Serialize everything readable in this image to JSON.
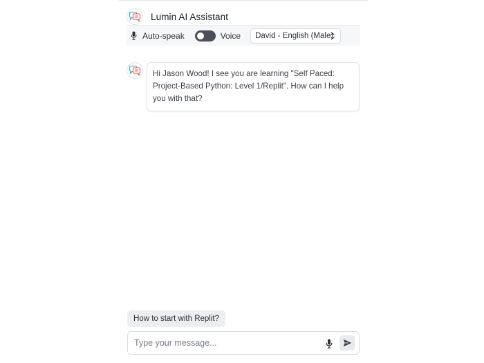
{
  "header": {
    "title": "Lumin AI Assistant",
    "logo_icon": "chat-bubbles-icon"
  },
  "controls": {
    "autospeak_label": "Auto-speak",
    "autospeak_enabled": false,
    "voice_label": "Voice",
    "voice_selected": "David - English (Male)",
    "icons": {
      "mic": "microphone-icon",
      "select": "chevron-up-down-icon"
    }
  },
  "messages": [
    {
      "sender": "assistant",
      "text": "Hi Jason Wood! I see you are learning \"Self Paced: Project-Based Python: Level 1/Replit\". How can I help you with that?"
    }
  ],
  "suggestions": [
    "How to start with Replit?"
  ],
  "composer": {
    "placeholder": "Type your message...",
    "value": "",
    "icons": {
      "mic": "microphone-icon",
      "send": "send-arrow-icon"
    }
  },
  "colors": {
    "logo_red": "#e0584f",
    "logo_teal": "#3aa7a3",
    "toggle_off": "#4b4f58",
    "chip_bg": "#eceef1",
    "controls_bg": "#f6f7f9"
  }
}
